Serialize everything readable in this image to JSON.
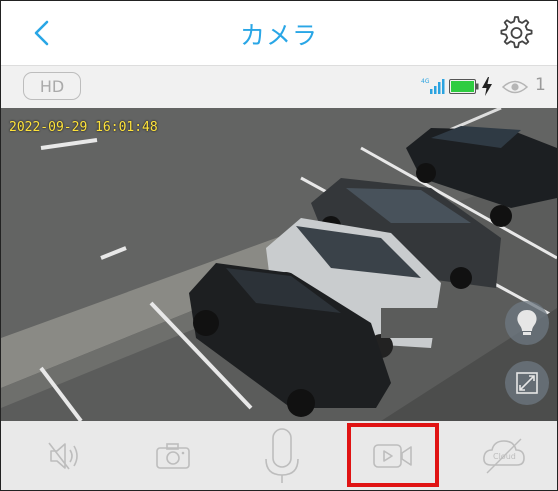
{
  "header": {
    "title": "カメラ",
    "back_icon": "chevron-left-icon",
    "settings_icon": "gear-icon"
  },
  "status": {
    "quality_label": "HD",
    "signal_label": "4G",
    "viewer_count": "1",
    "battery_color": "#2ecc40",
    "icons": [
      "signal-icon",
      "battery-icon",
      "charging-bolt-icon",
      "eye-icon"
    ]
  },
  "video": {
    "timestamp": "2022-09-29 16:01:48",
    "overlay_icons": [
      "light-bulb-icon",
      "fullscreen-icon"
    ]
  },
  "toolbar": {
    "items": [
      "mute-icon",
      "snapshot-camera-icon",
      "microphone-icon",
      "record-video-icon",
      "cloud-icon"
    ],
    "cloud_label": "Cloud",
    "highlight_color": "#e01313"
  },
  "colors": {
    "accent": "#29a6e6"
  }
}
